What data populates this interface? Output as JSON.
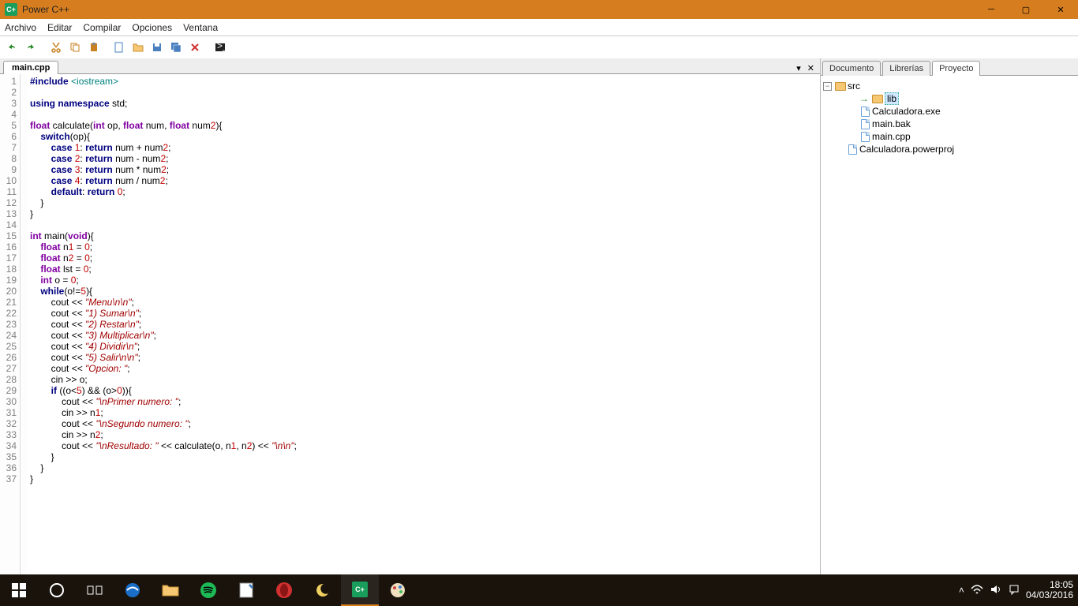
{
  "title": "Power C++",
  "menu": [
    "Archivo",
    "Editar",
    "Compilar",
    "Opciones",
    "Ventana"
  ],
  "tab": "main.cpp",
  "sideTabs": [
    "Documento",
    "Librerías",
    "Proyecto"
  ],
  "activeSideTab": 2,
  "tree": {
    "root": "src",
    "items": [
      {
        "name": "lib",
        "type": "folder",
        "selected": true
      },
      {
        "name": "Calculadora.exe",
        "type": "file"
      },
      {
        "name": "main.bak",
        "type": "file"
      },
      {
        "name": "main.cpp",
        "type": "file"
      },
      {
        "name": "Calculadora.powerproj",
        "type": "file",
        "indent": 1
      }
    ]
  },
  "code": [
    [
      {
        "t": "#include ",
        "c": "kw"
      },
      {
        "t": "<iostream>",
        "c": "inc"
      }
    ],
    [],
    [
      {
        "t": "using namespace ",
        "c": "kw"
      },
      {
        "t": "std;"
      }
    ],
    [],
    [
      {
        "t": "float ",
        "c": "ty"
      },
      {
        "t": "calculate("
      },
      {
        "t": "int ",
        "c": "ty"
      },
      {
        "t": "op, "
      },
      {
        "t": "float ",
        "c": "ty"
      },
      {
        "t": "num, "
      },
      {
        "t": "float ",
        "c": "ty"
      },
      {
        "t": "num"
      },
      {
        "t": "2",
        "c": "num"
      },
      {
        "t": "){"
      }
    ],
    [
      {
        "t": "    "
      },
      {
        "t": "switch",
        "c": "kw"
      },
      {
        "t": "(op){"
      }
    ],
    [
      {
        "t": "        "
      },
      {
        "t": "case ",
        "c": "kw"
      },
      {
        "t": "1",
        "c": "num"
      },
      {
        "t": ": "
      },
      {
        "t": "return ",
        "c": "kw"
      },
      {
        "t": "num + num"
      },
      {
        "t": "2",
        "c": "num"
      },
      {
        "t": ";"
      }
    ],
    [
      {
        "t": "        "
      },
      {
        "t": "case ",
        "c": "kw"
      },
      {
        "t": "2",
        "c": "num"
      },
      {
        "t": ": "
      },
      {
        "t": "return ",
        "c": "kw"
      },
      {
        "t": "num - num"
      },
      {
        "t": "2",
        "c": "num"
      },
      {
        "t": ";"
      }
    ],
    [
      {
        "t": "        "
      },
      {
        "t": "case ",
        "c": "kw"
      },
      {
        "t": "3",
        "c": "num"
      },
      {
        "t": ": "
      },
      {
        "t": "return ",
        "c": "kw"
      },
      {
        "t": "num * num"
      },
      {
        "t": "2",
        "c": "num"
      },
      {
        "t": ";"
      }
    ],
    [
      {
        "t": "        "
      },
      {
        "t": "case ",
        "c": "kw"
      },
      {
        "t": "4",
        "c": "num"
      },
      {
        "t": ": "
      },
      {
        "t": "return ",
        "c": "kw"
      },
      {
        "t": "num / num"
      },
      {
        "t": "2",
        "c": "num"
      },
      {
        "t": ";"
      }
    ],
    [
      {
        "t": "        "
      },
      {
        "t": "default",
        "c": "kw"
      },
      {
        "t": ": "
      },
      {
        "t": "return ",
        "c": "kw"
      },
      {
        "t": "0",
        "c": "num"
      },
      {
        "t": ";"
      }
    ],
    [
      {
        "t": "    }"
      }
    ],
    [
      {
        "t": "}"
      }
    ],
    [],
    [
      {
        "t": "int ",
        "c": "ty"
      },
      {
        "t": "main("
      },
      {
        "t": "void",
        "c": "ty"
      },
      {
        "t": "){"
      }
    ],
    [
      {
        "t": "    "
      },
      {
        "t": "float ",
        "c": "ty"
      },
      {
        "t": "n"
      },
      {
        "t": "1",
        "c": "num"
      },
      {
        "t": " = "
      },
      {
        "t": "0",
        "c": "num"
      },
      {
        "t": ";"
      }
    ],
    [
      {
        "t": "    "
      },
      {
        "t": "float ",
        "c": "ty"
      },
      {
        "t": "n"
      },
      {
        "t": "2",
        "c": "num"
      },
      {
        "t": " = "
      },
      {
        "t": "0",
        "c": "num"
      },
      {
        "t": ";"
      }
    ],
    [
      {
        "t": "    "
      },
      {
        "t": "float ",
        "c": "ty"
      },
      {
        "t": "lst = "
      },
      {
        "t": "0",
        "c": "num"
      },
      {
        "t": ";"
      }
    ],
    [
      {
        "t": "    "
      },
      {
        "t": "int ",
        "c": "ty"
      },
      {
        "t": "o = "
      },
      {
        "t": "0",
        "c": "num"
      },
      {
        "t": ";"
      }
    ],
    [
      {
        "t": "    "
      },
      {
        "t": "while",
        "c": "kw"
      },
      {
        "t": "(o!="
      },
      {
        "t": "5",
        "c": "num"
      },
      {
        "t": "){"
      }
    ],
    [
      {
        "t": "        cout << "
      },
      {
        "t": "\"Menu\\n\\n\"",
        "c": "str"
      },
      {
        "t": ";"
      }
    ],
    [
      {
        "t": "        cout << "
      },
      {
        "t": "\"1) Sumar\\n\"",
        "c": "str"
      },
      {
        "t": ";"
      }
    ],
    [
      {
        "t": "        cout << "
      },
      {
        "t": "\"2) Restar\\n\"",
        "c": "str"
      },
      {
        "t": ";"
      }
    ],
    [
      {
        "t": "        cout << "
      },
      {
        "t": "\"3) Multiplicar\\n\"",
        "c": "str"
      },
      {
        "t": ";"
      }
    ],
    [
      {
        "t": "        cout << "
      },
      {
        "t": "\"4) Dividir\\n\"",
        "c": "str"
      },
      {
        "t": ";"
      }
    ],
    [
      {
        "t": "        cout << "
      },
      {
        "t": "\"5) Salir\\n\\n\"",
        "c": "str"
      },
      {
        "t": ";"
      }
    ],
    [
      {
        "t": "        cout << "
      },
      {
        "t": "\"Opcion: \"",
        "c": "str"
      },
      {
        "t": ";"
      }
    ],
    [
      {
        "t": "        cin >> o;"
      }
    ],
    [
      {
        "t": "        "
      },
      {
        "t": "if ",
        "c": "kw"
      },
      {
        "t": "((o<"
      },
      {
        "t": "5",
        "c": "num"
      },
      {
        "t": ") && (o>"
      },
      {
        "t": "0",
        "c": "num"
      },
      {
        "t": ")){"
      }
    ],
    [
      {
        "t": "            cout << "
      },
      {
        "t": "\"\\nPrimer numero: \"",
        "c": "str"
      },
      {
        "t": ";"
      }
    ],
    [
      {
        "t": "            cin >> n"
      },
      {
        "t": "1",
        "c": "num"
      },
      {
        "t": ";"
      }
    ],
    [
      {
        "t": "            cout << "
      },
      {
        "t": "\"\\nSegundo numero: \"",
        "c": "str"
      },
      {
        "t": ";"
      }
    ],
    [
      {
        "t": "            cin >> n"
      },
      {
        "t": "2",
        "c": "num"
      },
      {
        "t": ";"
      }
    ],
    [
      {
        "t": "            cout << "
      },
      {
        "t": "\"\\nResultado: \"",
        "c": "str"
      },
      {
        "t": " << calculate(o, n"
      },
      {
        "t": "1",
        "c": "num"
      },
      {
        "t": ", n"
      },
      {
        "t": "2",
        "c": "num"
      },
      {
        "t": ") << "
      },
      {
        "t": "\"\\n\\n\"",
        "c": "str"
      },
      {
        "t": ";"
      }
    ],
    [
      {
        "t": "        }"
      }
    ],
    [
      {
        "t": "    }"
      }
    ],
    [
      {
        "t": "}"
      }
    ]
  ],
  "clock": {
    "time": "18:05",
    "date": "04/03/2016"
  }
}
